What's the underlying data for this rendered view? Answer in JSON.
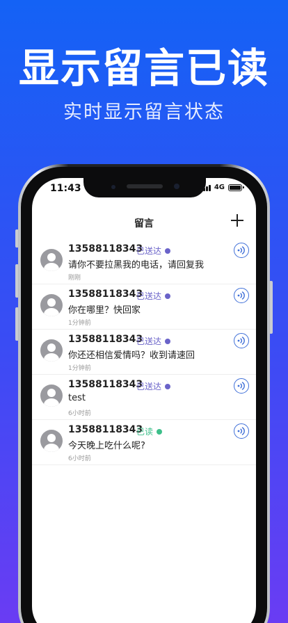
{
  "promo": {
    "title": "显示留言已读",
    "subtitle": "实时显示留言状态"
  },
  "status_bar": {
    "time": "11:43",
    "network": "4G"
  },
  "nav": {
    "title": "留言",
    "add_icon": "plus-icon"
  },
  "colors": {
    "sent": "#6a63c9",
    "read": "#3dbf8a",
    "accent": "#3f6fd8"
  },
  "messages": [
    {
      "phone": "13588118343",
      "status": "已送达",
      "status_type": "sent",
      "text": "请你不要拉黑我的电话，请回复我",
      "time": "刚刚"
    },
    {
      "phone": "13588118343",
      "status": "已送达",
      "status_type": "sent",
      "text": "你在哪里？快回家",
      "time": "1分钟前"
    },
    {
      "phone": "13588118343",
      "status": "已送达",
      "status_type": "sent",
      "text": "你还还相信爱情吗？收到请速回",
      "time": "1分钟前"
    },
    {
      "phone": "13588118343",
      "status": "已送达",
      "status_type": "sent",
      "text": "test",
      "time": "6小时前"
    },
    {
      "phone": "13588118343",
      "status": "已读",
      "status_type": "read",
      "text": "今天晚上吃什么呢?",
      "time": "6小时前"
    }
  ]
}
